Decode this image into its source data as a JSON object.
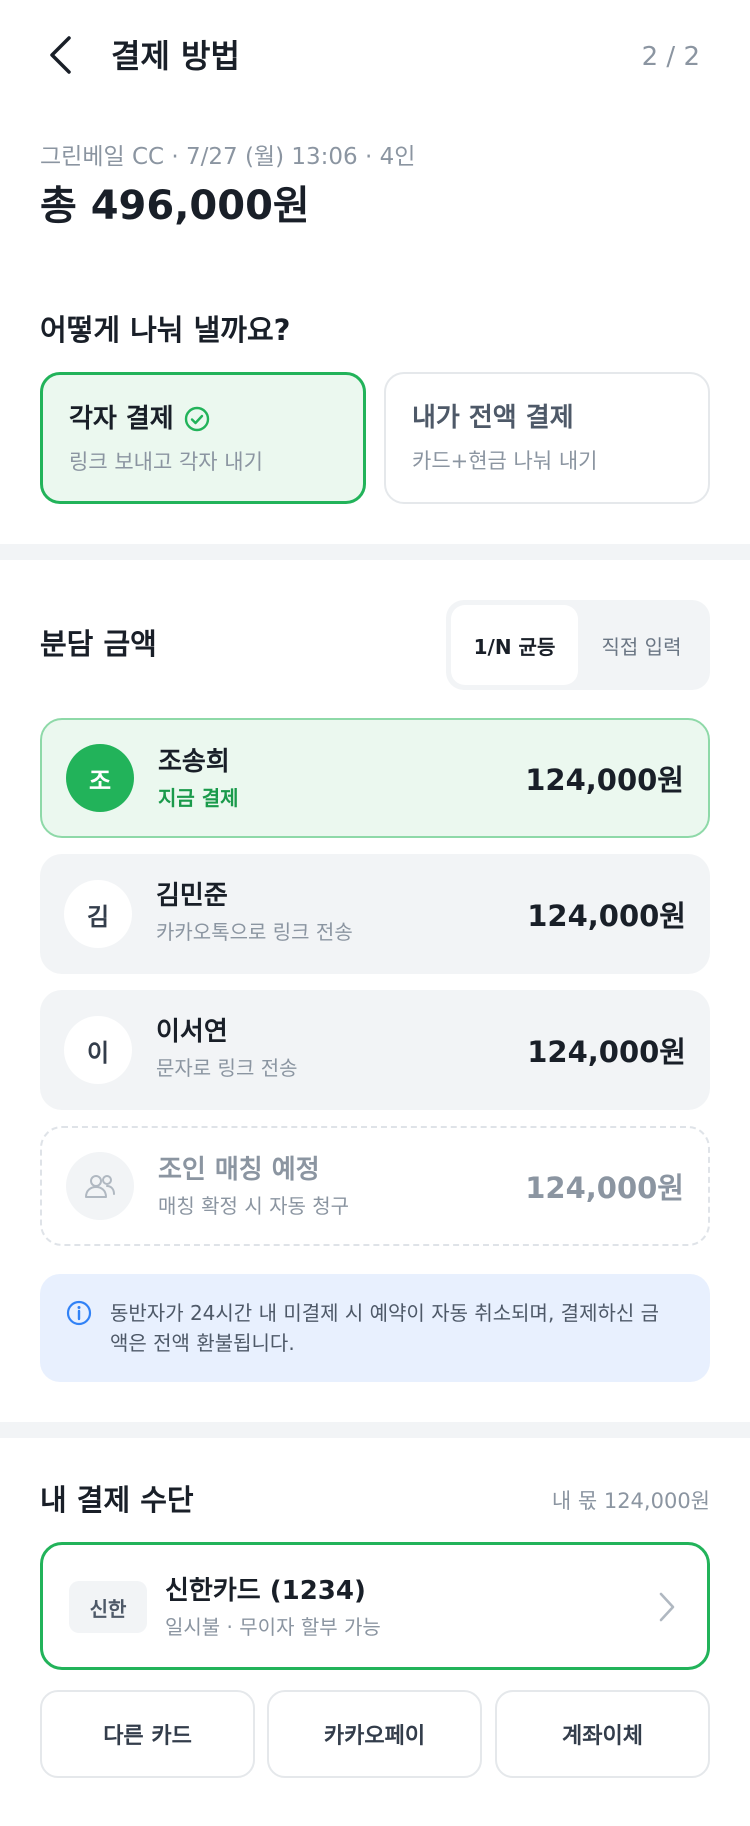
{
  "header": {
    "title": "결제 방법",
    "step": "2 / 2"
  },
  "booking": {
    "info": "그린베일 CC · 7/27 (월) 13:06 · 4인",
    "total": "총 496,000원"
  },
  "split_section": {
    "title": "어떻게 나눠 낼까요?",
    "options": [
      {
        "title": "각자 결제",
        "sub": "링크 보내고 각자 내기",
        "selected": true
      },
      {
        "title": "내가 전액 결제",
        "sub": "카드+현금 나눠 내기",
        "selected": false
      }
    ]
  },
  "share_section": {
    "title": "분담 금액",
    "tabs": [
      {
        "label": "1/N 균등",
        "active": true
      },
      {
        "label": "직접 입력",
        "active": false
      }
    ],
    "members": [
      {
        "initial": "조",
        "name": "조송희",
        "sub": "지금 결제",
        "amount": "124,000원"
      },
      {
        "initial": "김",
        "name": "김민준",
        "sub": "카카오톡으로 링크 전송",
        "amount": "124,000원"
      },
      {
        "initial": "이",
        "name": "이서연",
        "sub": "문자로 링크 전송",
        "amount": "124,000원"
      },
      {
        "icon": "people-icon",
        "name": "조인 매칭 예정",
        "sub": "매칭 확정 시 자동 청구",
        "amount": "124,000원"
      }
    ],
    "notice": "동반자가 24시간 내 미결제 시 예약이 자동 취소되며, 결제하신 금액은 전액 환불됩니다."
  },
  "payment_section": {
    "title": "내 결제 수단",
    "my_share": "내 몫 124,000원",
    "card": {
      "bank": "신한",
      "name": "신한카드 (1234)",
      "sub": "일시불 · 무이자 할부 가능"
    },
    "alternatives": [
      "다른 카드",
      "카카오페이",
      "계좌이체"
    ]
  },
  "colors": {
    "accent": "#22b35a",
    "accent_bg": "#ebf8ef",
    "notice_bg": "#e8f0fe",
    "text": "#191f28",
    "muted": "#8b95a1"
  }
}
